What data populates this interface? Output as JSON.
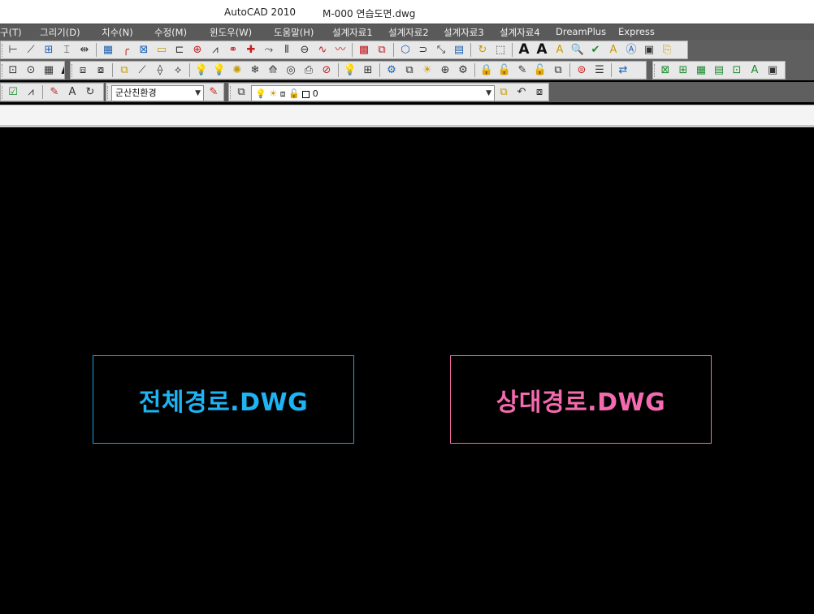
{
  "window": {
    "app_title": "AutoCAD 2010",
    "document_title": "M-000 연습도면.dwg"
  },
  "menu": {
    "items": [
      "구(T)",
      "그리기(D)",
      "치수(N)",
      "수정(M)",
      "윈도우(W)",
      "도움말(H)",
      "설계자료1",
      "설계자료2",
      "설계자료3",
      "설계자료4",
      "DreamPlus",
      "Express"
    ]
  },
  "toolbar": {
    "textstyle_combo": "군산친환경",
    "layer_combo": "0"
  },
  "drawing": {
    "absolute_path_label": "전체경로.DWG",
    "relative_path_label": "상대경로.DWG",
    "colors": {
      "absolute": "#1eb4f4",
      "relative": "#f46aaf",
      "background": "#000000"
    }
  }
}
